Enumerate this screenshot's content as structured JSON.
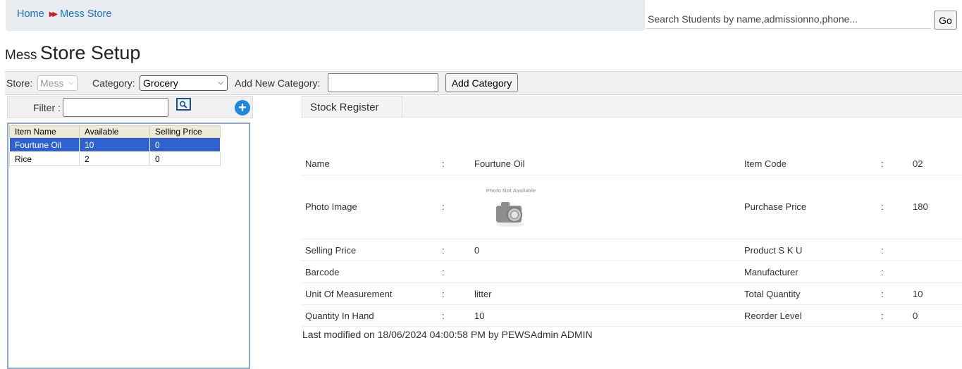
{
  "breadcrumb": {
    "home": "Home",
    "current": "Mess Store"
  },
  "search": {
    "placeholder": "Search Students by name,admissionno,phone...",
    "button": "Go"
  },
  "page_title": {
    "prefix": "Mess",
    "main": "Store Setup"
  },
  "toolbar": {
    "store_label": "Store:",
    "store_value": "Mess",
    "category_label": "Category:",
    "category_value": "Grocery",
    "new_category_label": "Add New Category:",
    "new_category_value": "",
    "add_category_button": "Add Category"
  },
  "filter": {
    "label": "Filter :",
    "value": ""
  },
  "items_table": {
    "headers": [
      "Item Name",
      "Available",
      "Selling Price"
    ],
    "rows": [
      {
        "name": "Fourtune Oil",
        "available": "10",
        "selling_price": "0",
        "selected": true
      },
      {
        "name": "Rice",
        "available": "2",
        "selling_price": "0",
        "selected": false
      }
    ]
  },
  "tabs": {
    "stock_register": "Stock Register"
  },
  "details": {
    "separator": ":",
    "name_label": "Name",
    "name_value": "Fourtune Oil",
    "item_code_label": "Item Code",
    "item_code_value": "02",
    "photo_label": "Photo Image",
    "photo_placeholder": "Photo Not Available",
    "purchase_price_label": "Purchase Price",
    "purchase_price_value": "180",
    "selling_price_label": "Selling Price",
    "selling_price_value": "0",
    "sku_label": "Product S K U",
    "sku_value": "",
    "barcode_label": "Barcode",
    "barcode_value": "",
    "manufacturer_label": "Manufacturer",
    "manufacturer_value": "",
    "uom_label": "Unit Of Measurement",
    "uom_value": "litter",
    "total_qty_label": "Total Quantity",
    "total_qty_value": "10",
    "qty_hand_label": "Quantity In Hand",
    "qty_hand_value": "10",
    "reorder_label": "Reorder Level",
    "reorder_value": "0"
  },
  "last_modified": "Last modified on 18/06/2024 04:00:58 PM by PEWSAdmin ADMIN"
}
